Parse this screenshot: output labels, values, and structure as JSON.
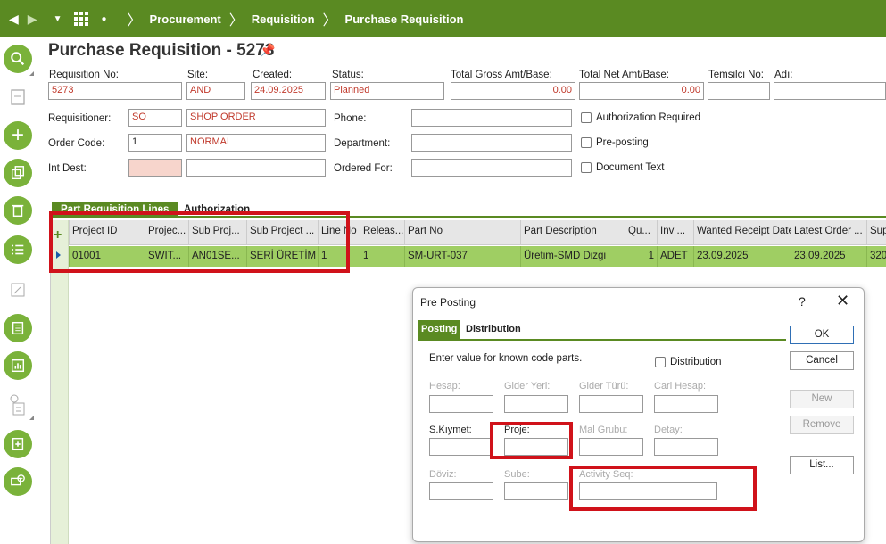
{
  "breadcrumb": [
    "Procurement",
    "Requisition",
    "Purchase Requisition"
  ],
  "page_title": "Purchase Requisition - 5273",
  "header": {
    "requisition_no": {
      "label": "Requisition No:",
      "value": "5273"
    },
    "site": {
      "label": "Site:",
      "value": "AND"
    },
    "created": {
      "label": "Created:",
      "value": "24.09.2025"
    },
    "status": {
      "label": "Status:",
      "value": "Planned"
    },
    "total_gross": {
      "label": "Total Gross Amt/Base:",
      "value": "0.00"
    },
    "total_net": {
      "label": "Total Net Amt/Base:",
      "value": "0.00"
    },
    "temsilci_no": {
      "label": "Temsilci No:",
      "value": ""
    },
    "adi": {
      "label": "Adı:",
      "value": ""
    }
  },
  "details": {
    "requisitioner": {
      "label": "Requisitioner:",
      "code": "SO",
      "desc": "SHOP ORDER"
    },
    "order_code": {
      "label": "Order Code:",
      "code": "1",
      "desc": "NORMAL"
    },
    "int_dest": {
      "label": "Int Dest:",
      "code": "",
      "desc": ""
    },
    "phone": {
      "label": "Phone:",
      "value": ""
    },
    "department": {
      "label": "Department:",
      "value": ""
    },
    "ordered_for": {
      "label": "Ordered For:",
      "value": ""
    },
    "checkboxes": [
      "Authorization Required",
      "Pre-posting",
      "Document Text"
    ]
  },
  "tabs": [
    "Part Requisition Lines",
    "Authorization"
  ],
  "grid": {
    "columns": [
      "Project ID",
      "Projec...",
      "Sub Proj...",
      "Sub Project ...",
      "Line No",
      "Releas...",
      "Part No",
      "Part Description",
      "Qu...",
      "Inv ...",
      "Wanted Receipt Date",
      "Latest Order ...",
      "Sup"
    ],
    "rows": [
      [
        "01001",
        "SWIT...",
        "AN01SE...",
        "SERİ ÜRETİM",
        "1",
        "1",
        "SM-URT-037",
        "Üretim-SMD Dizgi",
        "1",
        "ADET",
        "23.09.2025",
        "23.09.2025",
        "320"
      ]
    ]
  },
  "dialog": {
    "title": "Pre Posting",
    "help": "?",
    "close": "✕",
    "tabs": [
      "Posting",
      "Distribution"
    ],
    "instruction": "Enter value for known code parts.",
    "distribution_checkbox": "Distribution",
    "fields": [
      {
        "label": "Hesap:",
        "enabled": false
      },
      {
        "label": "Gider Yeri:",
        "enabled": false
      },
      {
        "label": "Gider Türü:",
        "enabled": false
      },
      {
        "label": "Cari Hesap:",
        "enabled": false
      },
      {
        "label": "S.Kıymet:",
        "enabled": true
      },
      {
        "label": "Proje:",
        "enabled": true
      },
      {
        "label": "Mal Grubu:",
        "enabled": false
      },
      {
        "label": "Detay:",
        "enabled": false
      },
      {
        "label": "Döviz:",
        "enabled": false
      },
      {
        "label": "Sube:",
        "enabled": false
      },
      {
        "label": "Activity Seq:",
        "enabled": false
      }
    ],
    "buttons": {
      "ok": "OK",
      "cancel": "Cancel",
      "new": "New",
      "remove": "Remove",
      "list": "List..."
    }
  }
}
